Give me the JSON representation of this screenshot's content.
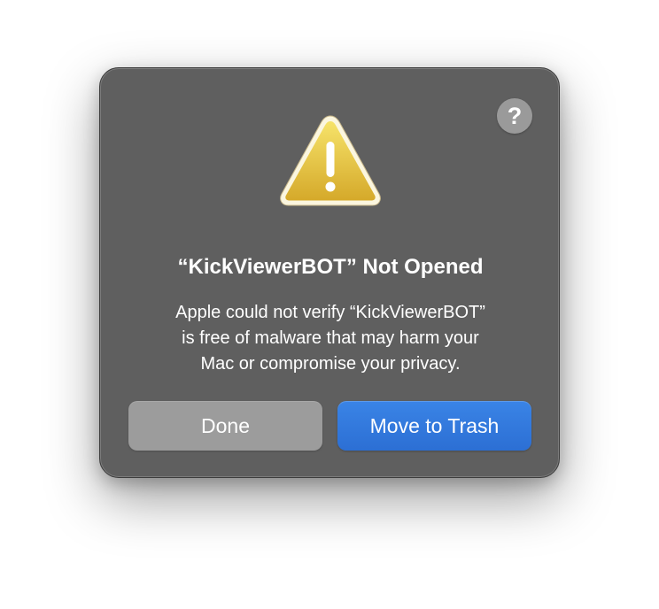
{
  "dialog": {
    "help_label": "?",
    "icon": "warning-triangle-icon",
    "title": "“KickViewerBOT” Not Opened",
    "message_lines": [
      "Apple could not verify “KickViewerBOT”",
      "is free of malware that may harm your",
      "Mac or compromise your privacy."
    ],
    "buttons": {
      "done_label": "Done",
      "trash_label": "Move to Trash"
    }
  },
  "colors": {
    "dialog_background": "#5f5f5f",
    "primary_button": "#2f74dc",
    "secondary_button": "#9c9c9c",
    "warning_yellow": "#e8c23a"
  }
}
